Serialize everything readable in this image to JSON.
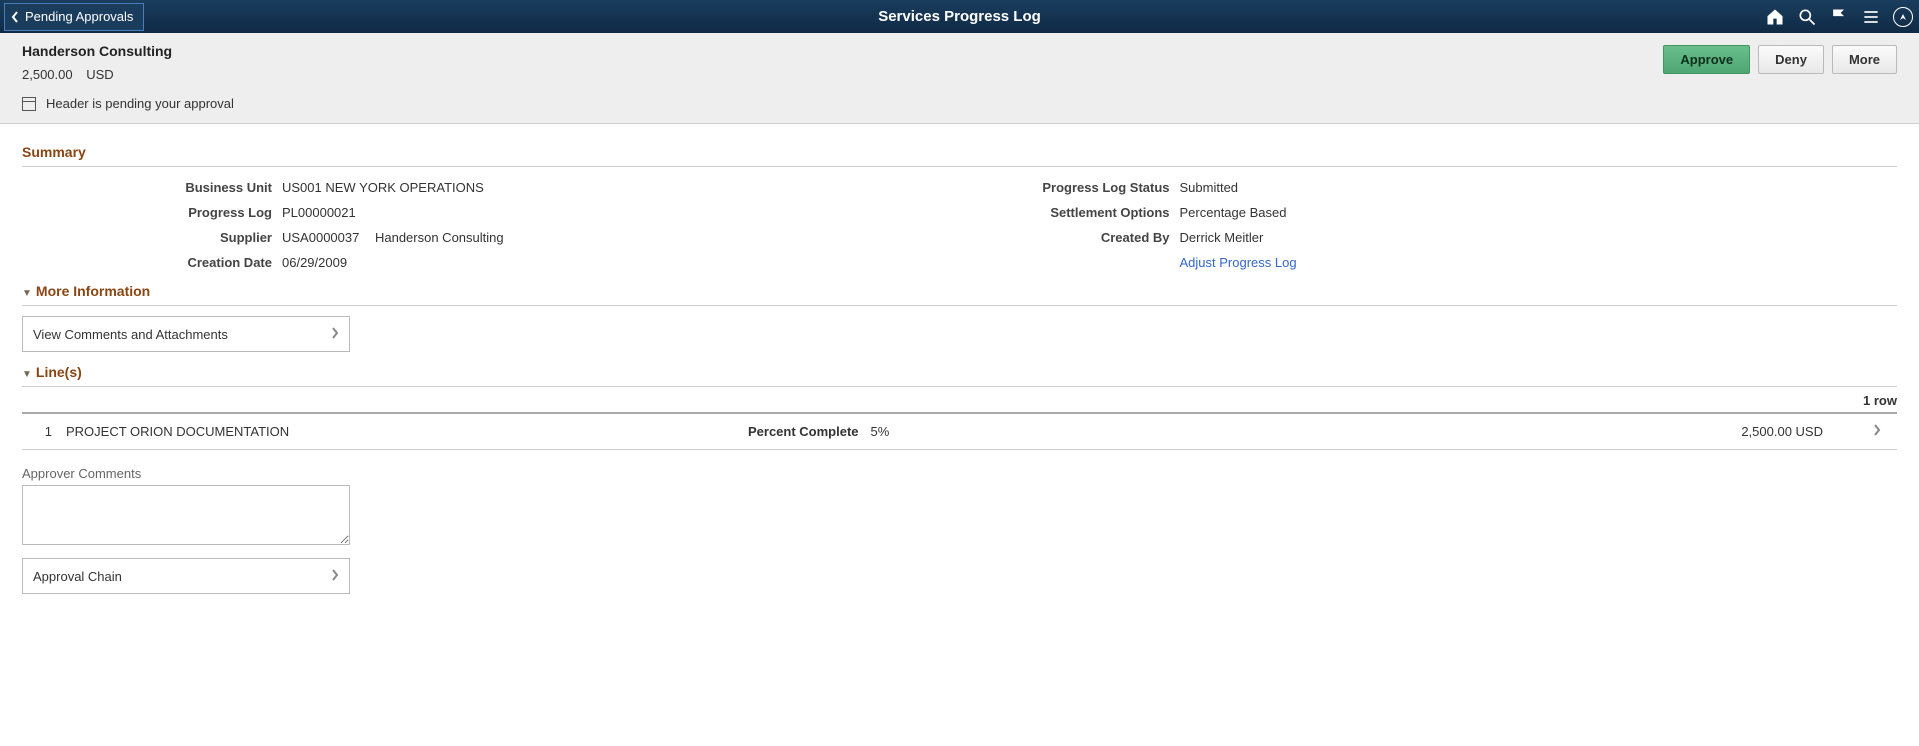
{
  "topbar": {
    "back_label": "Pending Approvals",
    "title": "Services Progress Log"
  },
  "header": {
    "company": "Handerson Consulting",
    "amount": "2,500.00",
    "currency": "USD",
    "status_msg": "Header is pending your approval",
    "buttons": {
      "approve": "Approve",
      "deny": "Deny",
      "more": "More"
    }
  },
  "sections": {
    "summary_title": "Summary",
    "more_info_title": "More Information",
    "lines_title": "Line(s)",
    "approver_comments_label": "Approver Comments"
  },
  "summary": {
    "left": {
      "business_unit_label": "Business Unit",
      "business_unit_value": "US001 NEW YORK OPERATIONS",
      "progress_log_label": "Progress Log",
      "progress_log_value": "PL00000021",
      "supplier_label": "Supplier",
      "supplier_id": "USA0000037",
      "supplier_name": "Handerson Consulting",
      "creation_date_label": "Creation Date",
      "creation_date_value": "06/29/2009"
    },
    "right": {
      "status_label": "Progress Log Status",
      "status_value": "Submitted",
      "settlement_label": "Settlement Options",
      "settlement_value": "Percentage Based",
      "created_by_label": "Created By",
      "created_by_value": "Derrick Meitler",
      "adjust_link": "Adjust Progress Log"
    }
  },
  "more_info": {
    "view_comments_label": "View Comments and Attachments"
  },
  "lines": {
    "row_count": "1 row",
    "items": [
      {
        "num": "1",
        "description": "PROJECT ORION DOCUMENTATION",
        "percent_complete_label": "Percent Complete",
        "percent_complete_value": "5%",
        "amount": "2,500.00 USD"
      }
    ]
  },
  "approval": {
    "approval_chain_label": "Approval Chain"
  }
}
